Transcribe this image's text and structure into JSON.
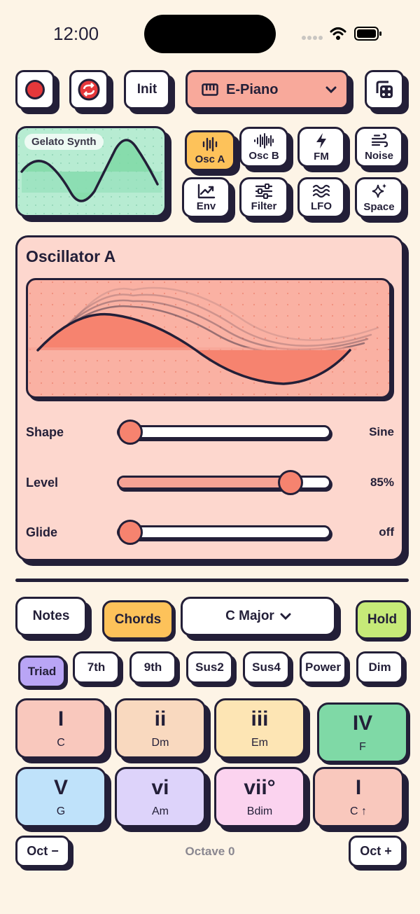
{
  "status": {
    "time": "12:00"
  },
  "toolbar": {
    "init_label": "Init",
    "preset_name": "E-Piano"
  },
  "preview": {
    "title": "Gelato Synth"
  },
  "tabs": [
    {
      "label": "Osc A",
      "icon": "waveform-icon"
    },
    {
      "label": "Osc B",
      "icon": "waveform-dense-icon"
    },
    {
      "label": "FM",
      "icon": "lightning-icon"
    },
    {
      "label": "Noise",
      "icon": "wind-icon"
    },
    {
      "label": "Env",
      "icon": "chart-line-icon"
    },
    {
      "label": "Filter",
      "icon": "sliders-icon"
    },
    {
      "label": "LFO",
      "icon": "waves-icon"
    },
    {
      "label": "Space",
      "icon": "sparkles-icon"
    }
  ],
  "panel": {
    "title": "Oscillator A",
    "sliders": [
      {
        "label": "Shape",
        "value": "Sine",
        "position": 0.0
      },
      {
        "label": "Level",
        "value": "85%",
        "position": 0.85
      },
      {
        "label": "Glide",
        "value": "off",
        "position": 0.0
      }
    ]
  },
  "keys": {
    "mode_notes": "Notes",
    "mode_chords": "Chords",
    "scale": "C Major",
    "hold": "Hold",
    "chord_types": [
      "Triad",
      "7th",
      "9th",
      "Sus2",
      "Sus4",
      "Power",
      "Dim"
    ],
    "pads": [
      {
        "numeral": "I",
        "chord": "C",
        "color": "#f9c8bd"
      },
      {
        "numeral": "ii",
        "chord": "Dm",
        "color": "#f9d9bf"
      },
      {
        "numeral": "iii",
        "chord": "Em",
        "color": "#fde5b4"
      },
      {
        "numeral": "IV",
        "chord": "F",
        "color": "#7fd9a6"
      },
      {
        "numeral": "V",
        "chord": "G",
        "color": "#bfe2fa"
      },
      {
        "numeral": "vi",
        "chord": "Am",
        "color": "#ddd3fa"
      },
      {
        "numeral": "vii°",
        "chord": "Bdim",
        "color": "#fbd3ef"
      },
      {
        "numeral": "I",
        "chord": "C ↑",
        "color": "#f9c8bd"
      }
    ],
    "oct_down": "Oct −",
    "octave": "Octave 0",
    "oct_up": "Oct +"
  },
  "colors": {
    "background": "#fdf4e6",
    "outline": "#231f38",
    "record": "#e5383b",
    "accent_salmon": "#f6836f",
    "selected_tab": "#fdc25a",
    "hold_green": "#c6ea78",
    "triad_purple": "#b9a5f5",
    "preview_green": "#b7ecd2"
  }
}
